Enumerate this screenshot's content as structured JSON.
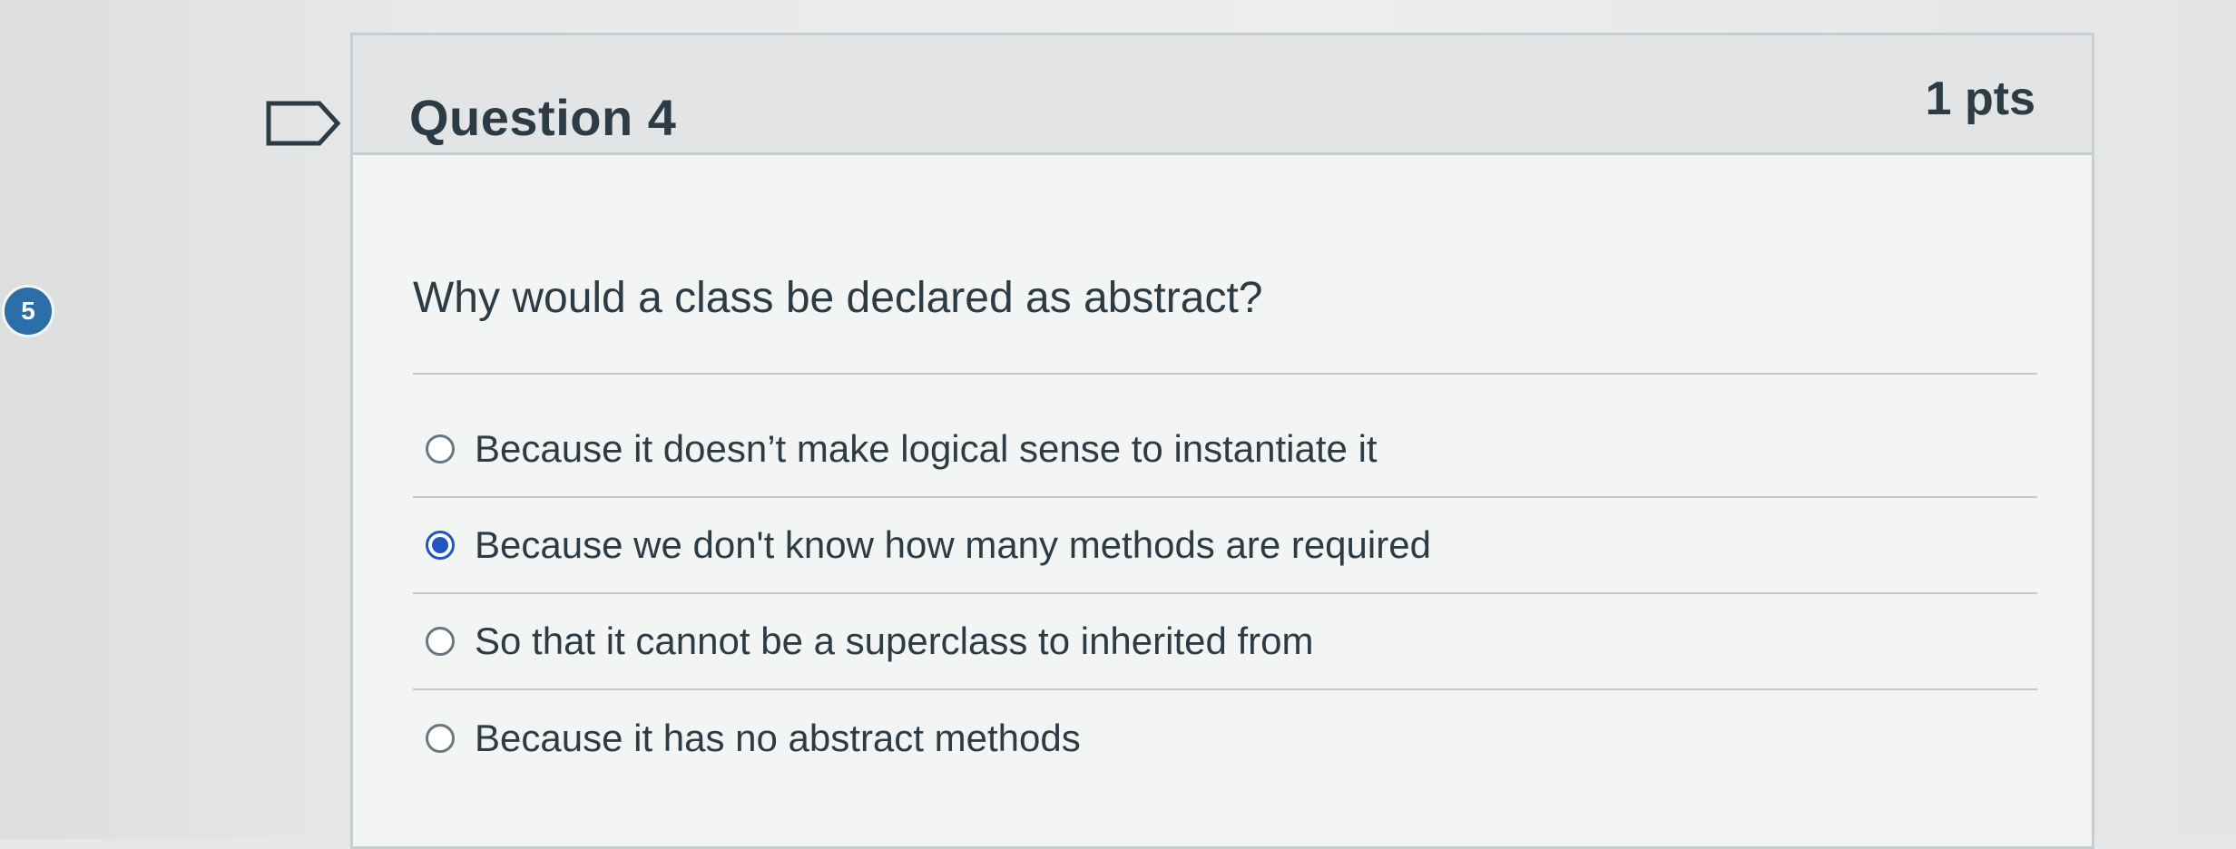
{
  "sidebar": {
    "question_number": "5"
  },
  "question": {
    "title": "Question 4",
    "points": "1 pts",
    "text": "Why would a class be declared as abstract?",
    "answers": [
      {
        "label": "Because it doesn’t make logical sense to instantiate it",
        "selected": false
      },
      {
        "label": "Because we don't know how many methods are required",
        "selected": true
      },
      {
        "label": "So that it cannot be a superclass to inherited from",
        "selected": false
      },
      {
        "label": "Because it has no abstract methods",
        "selected": false
      }
    ]
  },
  "colors": {
    "accent": "#1f56c0",
    "badge": "#2b6ea8",
    "text": "#2d3b45",
    "border": "#c7cdd1"
  },
  "icons": {
    "flag": "flag-outline-icon",
    "radio": "radio-button-icon"
  }
}
